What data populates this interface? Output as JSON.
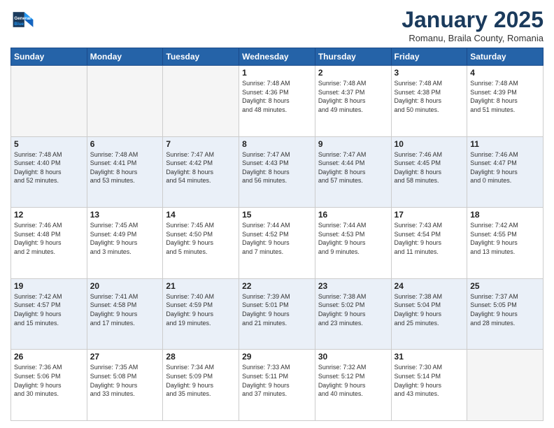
{
  "header": {
    "logo_line1": "General",
    "logo_line2": "Blue",
    "month_title": "January 2025",
    "subtitle": "Romanu, Braila County, Romania"
  },
  "weekdays": [
    "Sunday",
    "Monday",
    "Tuesday",
    "Wednesday",
    "Thursday",
    "Friday",
    "Saturday"
  ],
  "weeks": [
    [
      {
        "day": "",
        "info": ""
      },
      {
        "day": "",
        "info": ""
      },
      {
        "day": "",
        "info": ""
      },
      {
        "day": "1",
        "info": "Sunrise: 7:48 AM\nSunset: 4:36 PM\nDaylight: 8 hours\nand 48 minutes."
      },
      {
        "day": "2",
        "info": "Sunrise: 7:48 AM\nSunset: 4:37 PM\nDaylight: 8 hours\nand 49 minutes."
      },
      {
        "day": "3",
        "info": "Sunrise: 7:48 AM\nSunset: 4:38 PM\nDaylight: 8 hours\nand 50 minutes."
      },
      {
        "day": "4",
        "info": "Sunrise: 7:48 AM\nSunset: 4:39 PM\nDaylight: 8 hours\nand 51 minutes."
      }
    ],
    [
      {
        "day": "5",
        "info": "Sunrise: 7:48 AM\nSunset: 4:40 PM\nDaylight: 8 hours\nand 52 minutes."
      },
      {
        "day": "6",
        "info": "Sunrise: 7:48 AM\nSunset: 4:41 PM\nDaylight: 8 hours\nand 53 minutes."
      },
      {
        "day": "7",
        "info": "Sunrise: 7:47 AM\nSunset: 4:42 PM\nDaylight: 8 hours\nand 54 minutes."
      },
      {
        "day": "8",
        "info": "Sunrise: 7:47 AM\nSunset: 4:43 PM\nDaylight: 8 hours\nand 56 minutes."
      },
      {
        "day": "9",
        "info": "Sunrise: 7:47 AM\nSunset: 4:44 PM\nDaylight: 8 hours\nand 57 minutes."
      },
      {
        "day": "10",
        "info": "Sunrise: 7:46 AM\nSunset: 4:45 PM\nDaylight: 8 hours\nand 58 minutes."
      },
      {
        "day": "11",
        "info": "Sunrise: 7:46 AM\nSunset: 4:47 PM\nDaylight: 9 hours\nand 0 minutes."
      }
    ],
    [
      {
        "day": "12",
        "info": "Sunrise: 7:46 AM\nSunset: 4:48 PM\nDaylight: 9 hours\nand 2 minutes."
      },
      {
        "day": "13",
        "info": "Sunrise: 7:45 AM\nSunset: 4:49 PM\nDaylight: 9 hours\nand 3 minutes."
      },
      {
        "day": "14",
        "info": "Sunrise: 7:45 AM\nSunset: 4:50 PM\nDaylight: 9 hours\nand 5 minutes."
      },
      {
        "day": "15",
        "info": "Sunrise: 7:44 AM\nSunset: 4:52 PM\nDaylight: 9 hours\nand 7 minutes."
      },
      {
        "day": "16",
        "info": "Sunrise: 7:44 AM\nSunset: 4:53 PM\nDaylight: 9 hours\nand 9 minutes."
      },
      {
        "day": "17",
        "info": "Sunrise: 7:43 AM\nSunset: 4:54 PM\nDaylight: 9 hours\nand 11 minutes."
      },
      {
        "day": "18",
        "info": "Sunrise: 7:42 AM\nSunset: 4:55 PM\nDaylight: 9 hours\nand 13 minutes."
      }
    ],
    [
      {
        "day": "19",
        "info": "Sunrise: 7:42 AM\nSunset: 4:57 PM\nDaylight: 9 hours\nand 15 minutes."
      },
      {
        "day": "20",
        "info": "Sunrise: 7:41 AM\nSunset: 4:58 PM\nDaylight: 9 hours\nand 17 minutes."
      },
      {
        "day": "21",
        "info": "Sunrise: 7:40 AM\nSunset: 4:59 PM\nDaylight: 9 hours\nand 19 minutes."
      },
      {
        "day": "22",
        "info": "Sunrise: 7:39 AM\nSunset: 5:01 PM\nDaylight: 9 hours\nand 21 minutes."
      },
      {
        "day": "23",
        "info": "Sunrise: 7:38 AM\nSunset: 5:02 PM\nDaylight: 9 hours\nand 23 minutes."
      },
      {
        "day": "24",
        "info": "Sunrise: 7:38 AM\nSunset: 5:04 PM\nDaylight: 9 hours\nand 25 minutes."
      },
      {
        "day": "25",
        "info": "Sunrise: 7:37 AM\nSunset: 5:05 PM\nDaylight: 9 hours\nand 28 minutes."
      }
    ],
    [
      {
        "day": "26",
        "info": "Sunrise: 7:36 AM\nSunset: 5:06 PM\nDaylight: 9 hours\nand 30 minutes."
      },
      {
        "day": "27",
        "info": "Sunrise: 7:35 AM\nSunset: 5:08 PM\nDaylight: 9 hours\nand 33 minutes."
      },
      {
        "day": "28",
        "info": "Sunrise: 7:34 AM\nSunset: 5:09 PM\nDaylight: 9 hours\nand 35 minutes."
      },
      {
        "day": "29",
        "info": "Sunrise: 7:33 AM\nSunset: 5:11 PM\nDaylight: 9 hours\nand 37 minutes."
      },
      {
        "day": "30",
        "info": "Sunrise: 7:32 AM\nSunset: 5:12 PM\nDaylight: 9 hours\nand 40 minutes."
      },
      {
        "day": "31",
        "info": "Sunrise: 7:30 AM\nSunset: 5:14 PM\nDaylight: 9 hours\nand 43 minutes."
      },
      {
        "day": "",
        "info": ""
      }
    ]
  ]
}
